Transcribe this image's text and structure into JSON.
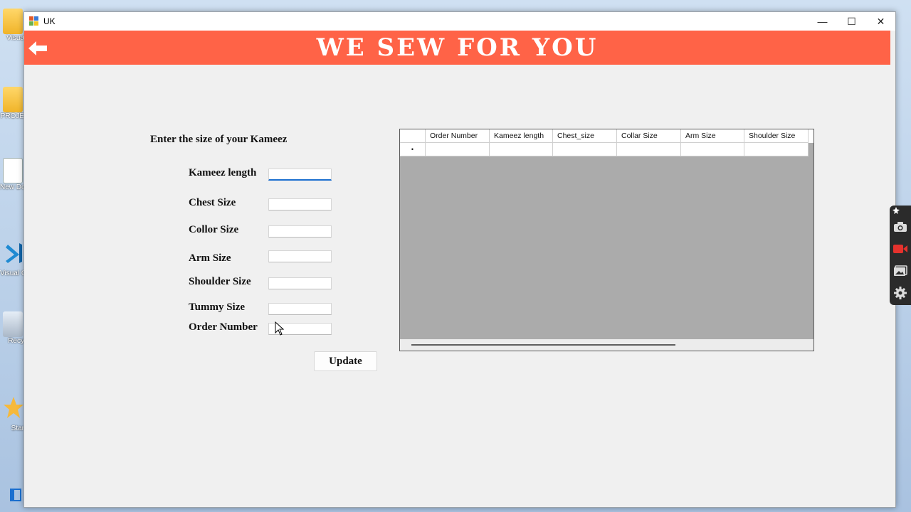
{
  "desktop": {
    "icons": [
      {
        "name": "visual-studio-folder",
        "label": "Visua"
      },
      {
        "name": "project-folder",
        "label": "PROJE"
      },
      {
        "name": "new-document",
        "label": "New\nDocu"
      },
      {
        "name": "visual-studio-code",
        "label": "Visual\nCo"
      },
      {
        "name": "recycle-bin",
        "label": "Recy"
      },
      {
        "name": "start-shortcut",
        "label": "Star"
      }
    ]
  },
  "window": {
    "title": "UK",
    "controls": {
      "minimize": "—",
      "maximize": "☐",
      "close": "✕"
    }
  },
  "banner": {
    "title": "WE SEW FOR YOU",
    "color": "#ff6347",
    "back_icon": "back-arrow-icon"
  },
  "form": {
    "heading": "Enter the size of your Kameez",
    "fields": [
      {
        "label": "Kameez length",
        "value": "",
        "focused": true
      },
      {
        "label": "Chest Size",
        "value": ""
      },
      {
        "label": "Collor Size",
        "value": ""
      },
      {
        "label": "Arm Size",
        "value": ""
      },
      {
        "label": "Shoulder Size",
        "value": ""
      },
      {
        "label": "Tummy Size",
        "value": ""
      },
      {
        "label": "Order Number",
        "value": ""
      }
    ],
    "submit_label": "Update"
  },
  "grid": {
    "columns": [
      "Order Number",
      "Kameez length",
      "Chest_size",
      "Collar Size",
      "Arm Size",
      "Shoulder Size"
    ],
    "new_row_marker": "•",
    "rows": [
      [
        "",
        "",
        "",
        "",
        "",
        ""
      ]
    ]
  },
  "capture_toolbar": {
    "buttons": [
      "camera-icon",
      "video-record-icon",
      "gallery-icon",
      "gear-icon"
    ]
  }
}
